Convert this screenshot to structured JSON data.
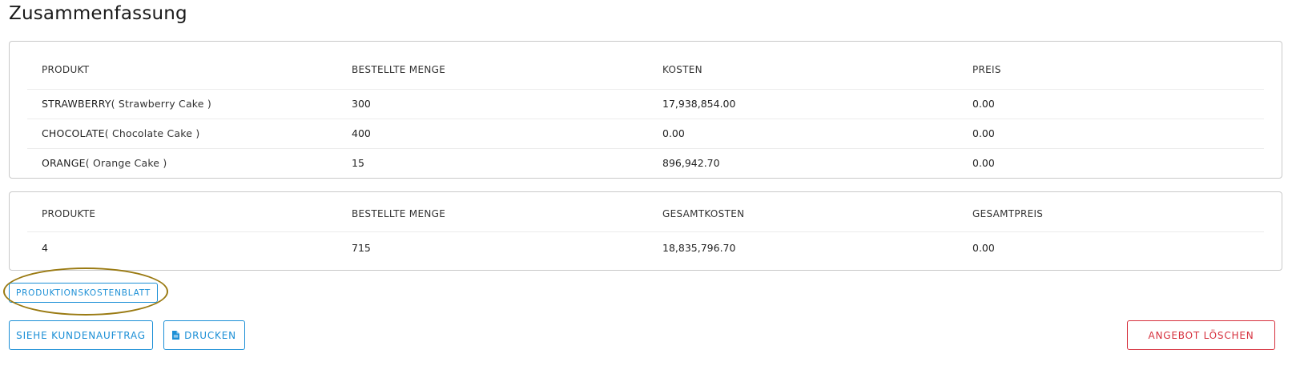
{
  "page": {
    "title": "Zusammenfassung"
  },
  "products_table": {
    "headers": [
      "PRODUKT",
      "BESTELLTE MENGE",
      "KOSTEN",
      "PREIS"
    ],
    "rows": [
      {
        "product": "STRAWBERRY",
        "description": "( Strawberry Cake )",
        "quantity": "300",
        "cost": "17,938,854.00",
        "price": "0.00"
      },
      {
        "product": "CHOCOLATE",
        "description": "( Chocolate Cake )",
        "quantity": "400",
        "cost": "0.00",
        "price": "0.00"
      },
      {
        "product": "ORANGE",
        "description": "( Orange Cake )",
        "quantity": "15",
        "cost": "896,942.70",
        "price": "0.00"
      }
    ]
  },
  "totals_table": {
    "headers": [
      "PRODUKTE",
      "BESTELLTE MENGE",
      "GESAMTKOSTEN",
      "GESAMTPREIS"
    ],
    "row": {
      "products": "4",
      "quantity": "715",
      "total_cost": "18,835,796.70",
      "total_price": "0.00"
    }
  },
  "buttons": {
    "cost_sheet": "PRODUKTIONSKOSTENBLATT",
    "view_order": "SIEHE KUNDENAUFTRAG",
    "print": "DRUCKEN",
    "delete_offer": "ANGEBOT LÖSCHEN"
  },
  "icons": {
    "print": "file-icon"
  },
  "colors": {
    "primary": "#1b8fd6",
    "danger": "#d6303d",
    "highlight": "#9a7a12"
  }
}
